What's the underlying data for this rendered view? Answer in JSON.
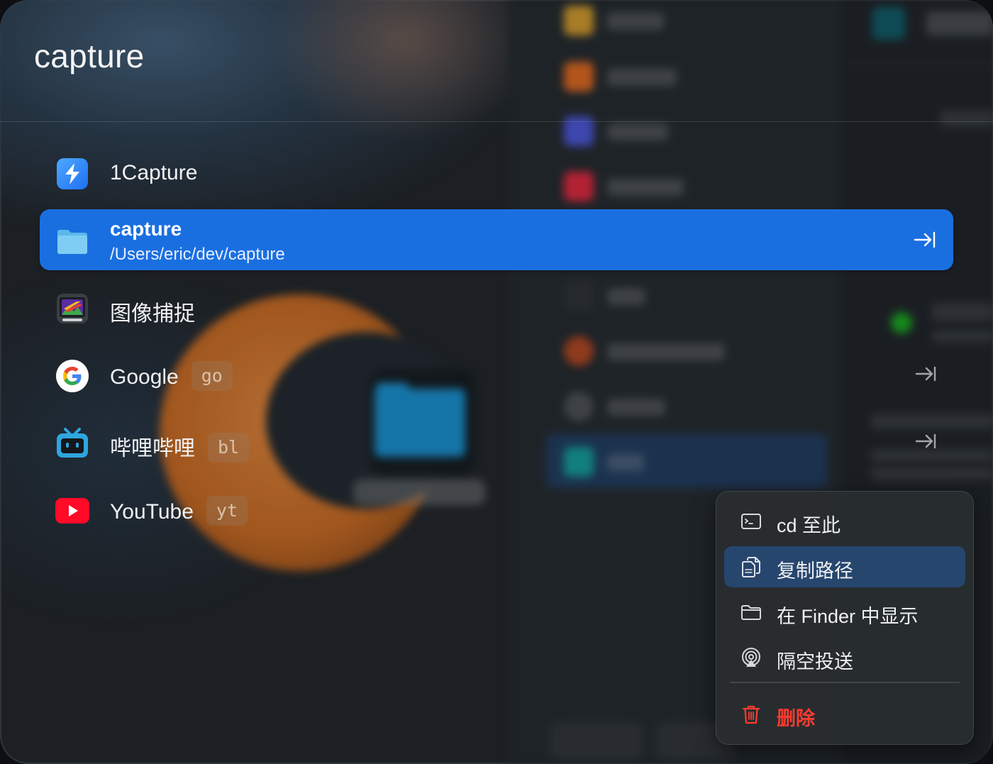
{
  "search": {
    "query": "capture"
  },
  "results": [
    {
      "title": "1Capture",
      "icon": "1capture-app-icon"
    },
    {
      "title": "capture",
      "subtitle": "/Users/eric/dev/capture",
      "icon": "folder-icon",
      "selected": true
    },
    {
      "title": "图像捕捉",
      "icon": "image-capture-app-icon"
    },
    {
      "title": "Google",
      "alias": "go",
      "icon": "google-icon"
    },
    {
      "title": "哔哩哔哩",
      "alias": "bl",
      "icon": "bilibili-icon"
    },
    {
      "title": "YouTube",
      "alias": "yt",
      "icon": "youtube-icon"
    }
  ],
  "context_menu": {
    "items": [
      {
        "label": "cd 至此",
        "icon": "terminal-icon"
      },
      {
        "label": "复制路径",
        "icon": "copy-icon",
        "highlighted": true
      },
      {
        "label": "在 Finder 中显示",
        "icon": "folder-outline-icon"
      },
      {
        "label": "隔空投送",
        "icon": "airdrop-icon"
      },
      {
        "label": "删除",
        "icon": "trash-icon",
        "danger": true
      }
    ]
  },
  "colors": {
    "selection": "#1a6fe0",
    "menu_highlight": "#26466e",
    "danger": "#ff3b30",
    "text": "#f1f2f4"
  }
}
